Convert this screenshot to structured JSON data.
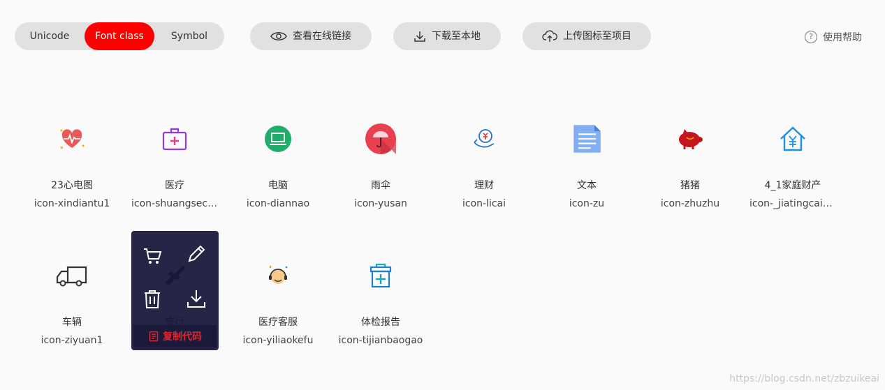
{
  "tabs": [
    "Unicode",
    "Font class",
    "Symbol"
  ],
  "active_tab": "Font class",
  "actions": {
    "view_link": "查看在线链接",
    "download": "下载至本地",
    "upload": "上传图标至项目"
  },
  "help": {
    "label": "使用帮助",
    "glyph": "?"
  },
  "icons": [
    {
      "name": "23心电图",
      "code": "icon-xindiantu1",
      "icon": "heart-ecg-icon"
    },
    {
      "name": "医疗",
      "code": "icon-shuangsech...",
      "icon": "medical-kit-icon"
    },
    {
      "name": "电脑",
      "code": "icon-diannao",
      "icon": "computer-icon"
    },
    {
      "name": "雨伞",
      "code": "icon-yusan",
      "icon": "umbrella-icon"
    },
    {
      "name": "理财",
      "code": "icon-licai",
      "icon": "finance-hand-icon"
    },
    {
      "name": "文本",
      "code": "icon-zu",
      "icon": "document-icon"
    },
    {
      "name": "猪猪",
      "code": "icon-zhuzhu",
      "icon": "pig-icon"
    },
    {
      "name": "4_1家庭财产",
      "code": "icon-_jiatingcaic...",
      "icon": "house-yuan-icon"
    },
    {
      "name": "车辆",
      "code": "icon-ziyuan1",
      "icon": "truck-icon"
    },
    {
      "name": "旅行",
      "code": "",
      "icon": "airplane-icon"
    },
    {
      "name": "医疗客服",
      "code": "icon-yiliaokefu",
      "icon": "medical-support-icon"
    },
    {
      "name": "体检报告",
      "code": "icon-tijianbaogao",
      "icon": "checkup-report-icon"
    }
  ],
  "overlay": {
    "copy_label": "复制代码",
    "buttons": [
      "cart-icon",
      "edit-icon",
      "trash-icon",
      "download-icon"
    ]
  },
  "watermark": "https://blog.csdn.net/zbzuikeai",
  "colors": {
    "accent": "#ff0000",
    "overlay_bg": "#161437",
    "copy_text": "#e0242b"
  }
}
